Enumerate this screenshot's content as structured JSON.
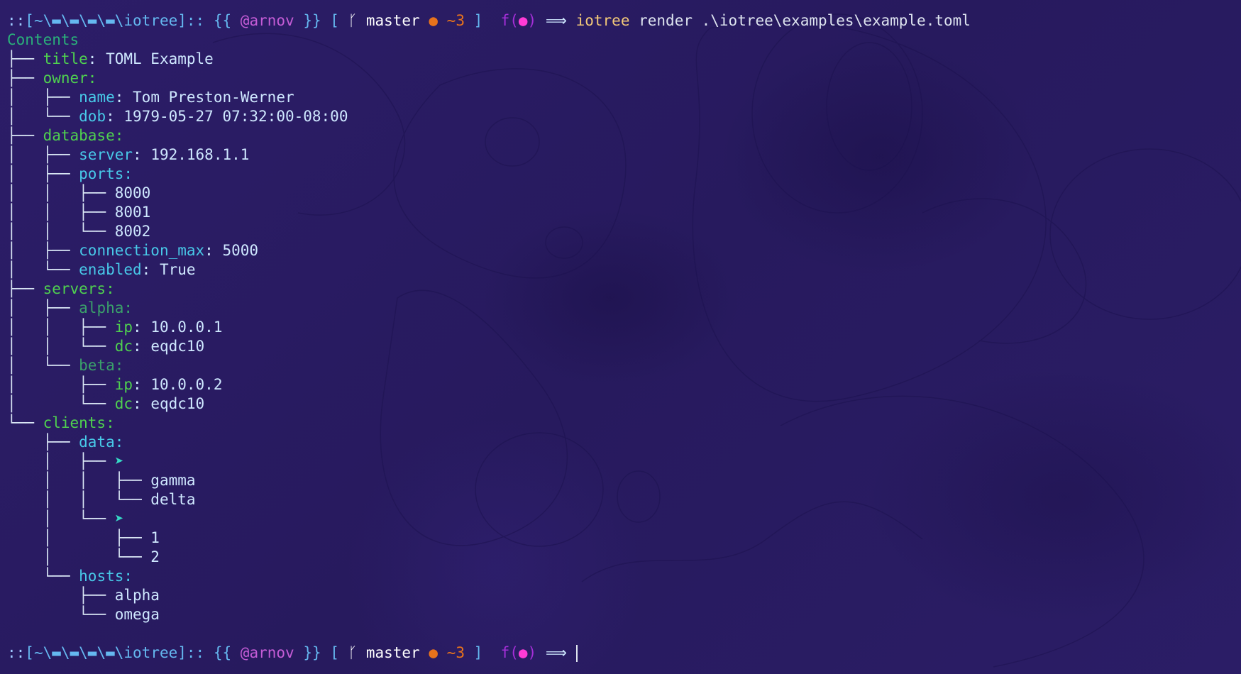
{
  "prompt": {
    "prefix": "::",
    "path_open": "[~\\",
    "folder_icon_count": 4,
    "dir": "iotree",
    "path_close": "]::",
    "brace_open": "{{",
    "user": "@arnov",
    "brace_close": "}}",
    "bracket_open": "[",
    "branch_icon": "git-branch-icon",
    "branch": "master",
    "status_dot": "●",
    "changes": "~3",
    "bracket_close": "]",
    "fn_label": "f(●)",
    "arrow": "⟹"
  },
  "command": {
    "name": "iotree",
    "args": "render .\\iotree\\examples\\example.toml"
  },
  "tree": {
    "root": "Contents",
    "title_key": "title",
    "title_value": "TOML Example",
    "owner_key": "owner:",
    "owner_name_key": "name",
    "owner_name_value": "Tom Preston-Werner",
    "owner_dob_key": "dob",
    "owner_dob_value": "1979-05-27 07:32:00-08:00",
    "database_key": "database:",
    "server_key": "server",
    "server_value": "192.168.1.1",
    "ports_key": "ports:",
    "ports": [
      "8000",
      "8001",
      "8002"
    ],
    "connection_max_key": "connection_max",
    "connection_max_value": "5000",
    "enabled_key": "enabled",
    "enabled_value": "True",
    "servers_key": "servers:",
    "alpha_key": "alpha:",
    "alpha_ip_key": "ip",
    "alpha_ip_value": "10.0.0.1",
    "alpha_dc_key": "dc",
    "alpha_dc_value": "eqdc10",
    "beta_key": "beta:",
    "beta_ip_key": "ip",
    "beta_ip_value": "10.0.0.2",
    "beta_dc_key": "dc",
    "beta_dc_value": "eqdc10",
    "clients_key": "clients:",
    "data_key": "data:",
    "list_marker": "➤",
    "data_list1": [
      "gamma",
      "delta"
    ],
    "data_list2": [
      "1",
      "2"
    ],
    "hosts_key": "hosts:",
    "hosts": [
      "alpha",
      "omega"
    ]
  },
  "colors": {
    "background": "#2a1c63",
    "key_green": "#4fd14f",
    "key_cyan": "#48c9e8",
    "prompt_user": "#c45cd6",
    "status_orange": "#e8731c",
    "command_yellow": "#f2c879"
  }
}
